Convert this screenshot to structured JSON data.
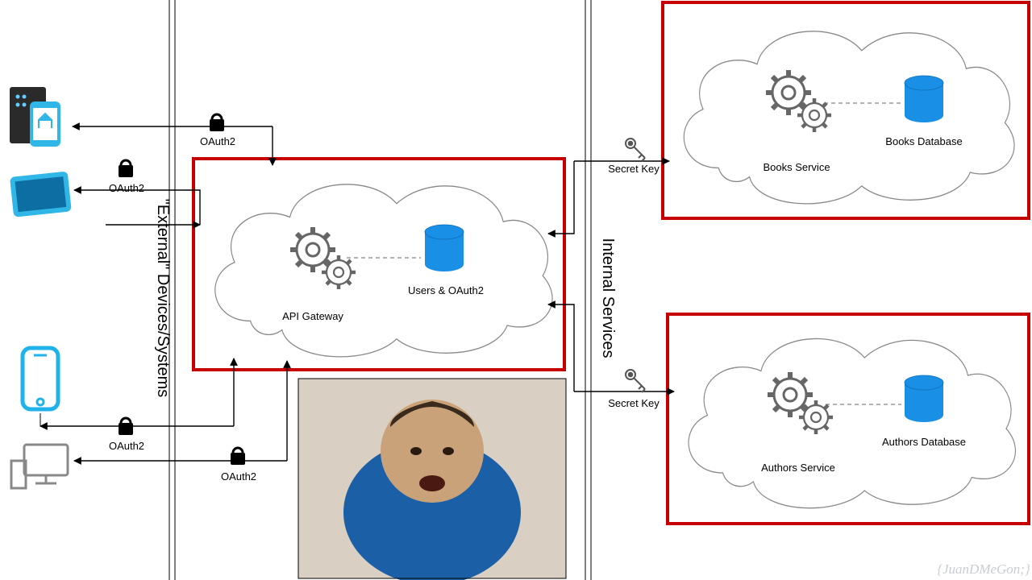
{
  "sections": {
    "external_label": "\"External\" Devices/Systems",
    "internal_label": "Internal Services"
  },
  "oauth": {
    "l1": "OAuth2",
    "l2": "OAuth2",
    "l3": "OAuth2",
    "l4": "OAuth2"
  },
  "keys": {
    "top": "Secret Key",
    "bottom": "Secret Key"
  },
  "gateway": {
    "service": "API Gateway",
    "db": "Users & OAuth2"
  },
  "books": {
    "service": "Books Service",
    "db": "Books Database"
  },
  "authors": {
    "service": "Authors Service",
    "db": "Authors Database"
  },
  "watermark": "{JuanDMeGon;}"
}
